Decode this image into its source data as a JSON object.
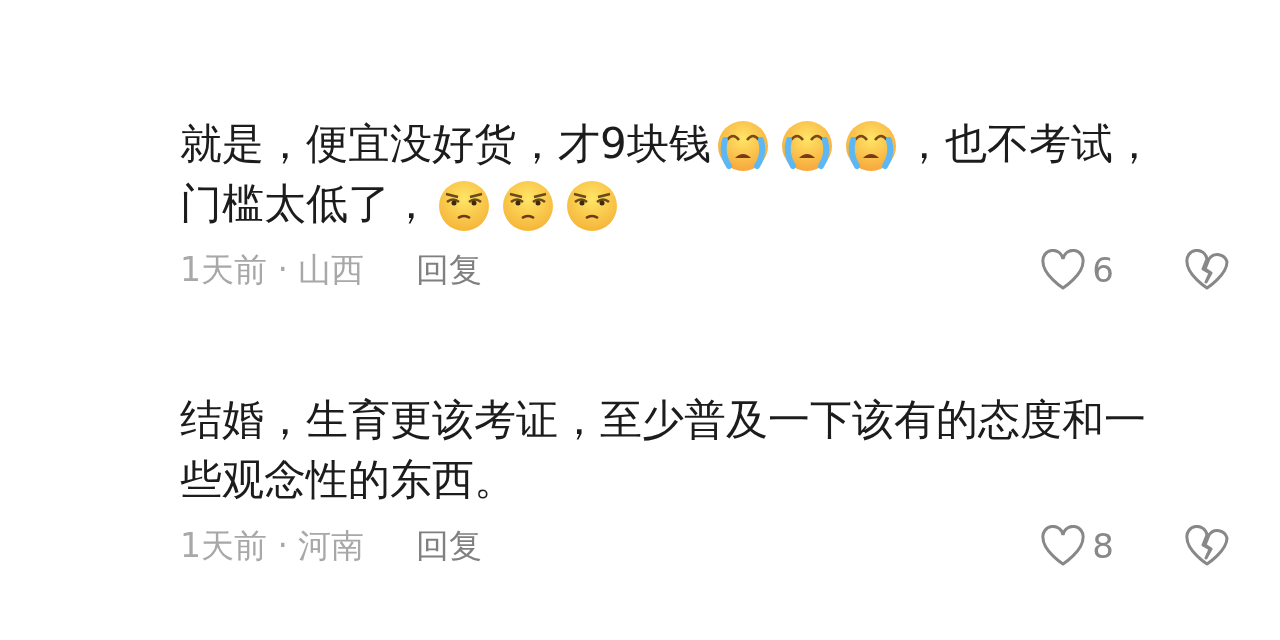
{
  "comments": [
    {
      "lines": [
        [
          {
            "kind": "text",
            "text": "就是，便宜没好货，才9块钱"
          },
          {
            "kind": "crying"
          },
          {
            "kind": "crying"
          },
          {
            "kind": "crying"
          },
          {
            "kind": "text",
            "text": "，也不考试，"
          }
        ],
        [
          {
            "kind": "text",
            "text": "门槛太低了，"
          },
          {
            "kind": "squint"
          },
          {
            "kind": "squint"
          },
          {
            "kind": "squint"
          }
        ]
      ],
      "meta": "1天前 · 山西",
      "reply": "回复",
      "likes": "6"
    },
    {
      "lines": [
        [
          {
            "kind": "text",
            "text": "结婚，生育更该考证，至少普及一下该有的态度和一"
          }
        ],
        [
          {
            "kind": "text",
            "text": "些观念性的东西。"
          }
        ]
      ],
      "meta": "1天前 · 河南",
      "reply": "回复",
      "likes": "8"
    }
  ]
}
